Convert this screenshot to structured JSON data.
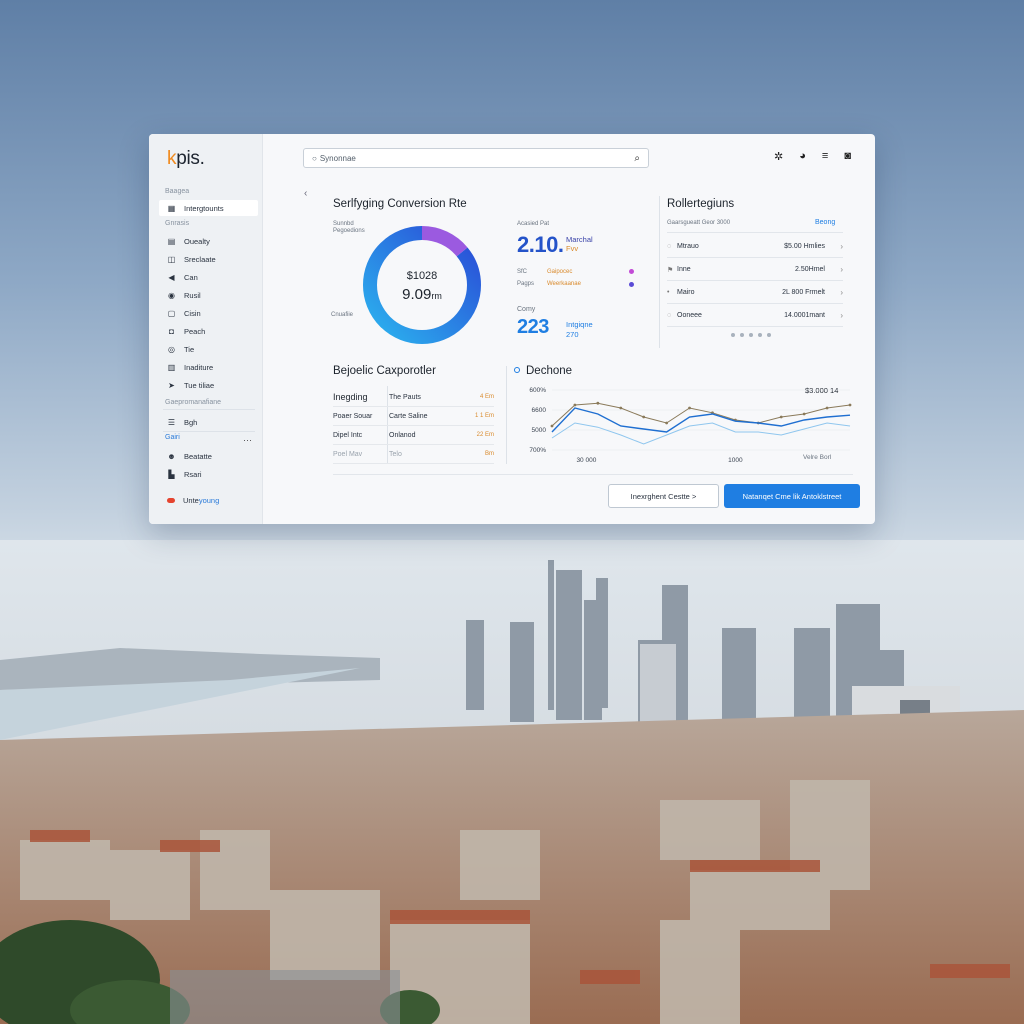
{
  "app": {
    "logo": "kpis.",
    "search_placeholder": "Synonnae"
  },
  "sidebar": {
    "section_top": "Baagea",
    "active_item": "Intergtounts",
    "section_2": "Gnrasis",
    "items": [
      {
        "label": "Ouealty",
        "icon": "calendar-icon"
      },
      {
        "label": "Sreclaate",
        "icon": "chat-icon"
      },
      {
        "label": "Can",
        "icon": "megaphone-icon"
      },
      {
        "label": "Rusil",
        "icon": "user-circle-icon"
      },
      {
        "label": "Cisin",
        "icon": "document-icon"
      },
      {
        "label": "Peach",
        "icon": "chat-bubble-icon"
      },
      {
        "label": "Tie",
        "icon": "target-icon"
      },
      {
        "label": "Inaditure",
        "icon": "bar-chart-icon"
      },
      {
        "label": "Tue tiliae",
        "icon": "send-icon"
      }
    ],
    "section_3": "Gaepromanafiane",
    "items_2": [
      {
        "label": "Bgh",
        "icon": "list-icon"
      }
    ],
    "section_4": "Gairi",
    "items_3": [
      {
        "label": "Beatatte",
        "icon": "people-icon"
      },
      {
        "label": "Rsari",
        "icon": "briefcase-icon"
      }
    ],
    "upgrade_label": "Unte",
    "upgrade_highlight": "young"
  },
  "conversion_card": {
    "title": "Serlfyging Conversion Rte",
    "small_label_1": "Sunnbd",
    "small_label_2": "Pegoedions",
    "donut_value_1": "$1028",
    "donut_value_2": "9.09",
    "donut_unit": "rm",
    "donut_caption": "Cnuafiie",
    "donut_share": 0.86
  },
  "metric_card": {
    "label": "Acasied Pat",
    "value": "2.10.",
    "side_1": "Marchal",
    "side_2": "Fvv",
    "row_1_label": "SfC",
    "row_1_value": "Gaipocec",
    "row_2_label": "Pagps",
    "row_2_value": "Weerkaanae",
    "sub_label": "Comy",
    "sub_value": "223",
    "sub_side_1": "Intgiqne",
    "sub_side_2": "270",
    "dot_1_color": "#c24bd6",
    "dot_2_color": "#5b4bd6"
  },
  "regions_card": {
    "title": "Rollertegiuns",
    "subtitle": "Gaarsgueatt Geor 3000",
    "link": "Beong",
    "rows": [
      {
        "icon": "globe-icon",
        "a": "Mtrauo",
        "b": "$5.00 Hmlies"
      },
      {
        "icon": "flag-icon",
        "a": "Inne",
        "b": "2.50Hmel"
      },
      {
        "icon": "pin-icon",
        "a": "Mairo",
        "b": "2L 800 Frmelt"
      },
      {
        "icon": "globe-icon",
        "a": "Ooneee",
        "b": "14.0001mant"
      }
    ]
  },
  "bottom_left": {
    "title": "Bejoelic Caxporotler",
    "rows": [
      {
        "c1": "Inegding",
        "c2": "The Pauts",
        "c3": "4 Em"
      },
      {
        "c1": "Poaer Souar",
        "c2": "Carte Saline",
        "c3": "1 1 Em"
      },
      {
        "c1": "Dipel Intc",
        "c2": "Onlanod",
        "c3": "22 Em"
      },
      {
        "c1": "Poel Mav",
        "c2": "Telo",
        "c3": "Bm"
      }
    ]
  },
  "trend_card": {
    "title": "Dechone",
    "top_right": "$3.000 14",
    "bottom_right": "Velre Borl"
  },
  "chart_data": {
    "type": "line",
    "title": "Dechone",
    "y_ticks": [
      "600%",
      "6600",
      "5000",
      "700%"
    ],
    "x_ticks": [
      "30 000",
      "1000"
    ],
    "ylim": [
      0,
      100
    ],
    "x": [
      0,
      1,
      2,
      3,
      4,
      5,
      6,
      7,
      8,
      9,
      10,
      11,
      12,
      13
    ],
    "series": [
      {
        "color": "#8a7a5a",
        "values": [
          40,
          75,
          78,
          70,
          55,
          45,
          70,
          62,
          50,
          45,
          55,
          60,
          70,
          75
        ]
      },
      {
        "color": "#1f6fd1",
        "values": [
          30,
          70,
          60,
          40,
          35,
          30,
          55,
          60,
          48,
          45,
          40,
          50,
          55,
          58
        ]
      },
      {
        "color": "#8fc6ee",
        "values": [
          20,
          45,
          38,
          25,
          10,
          25,
          40,
          45,
          30,
          30,
          25,
          35,
          45,
          40
        ]
      }
    ]
  },
  "buttons": {
    "secondary": "Inexrghent Cestte >",
    "primary": "Natanqet Cme lik Antoklstreet"
  }
}
